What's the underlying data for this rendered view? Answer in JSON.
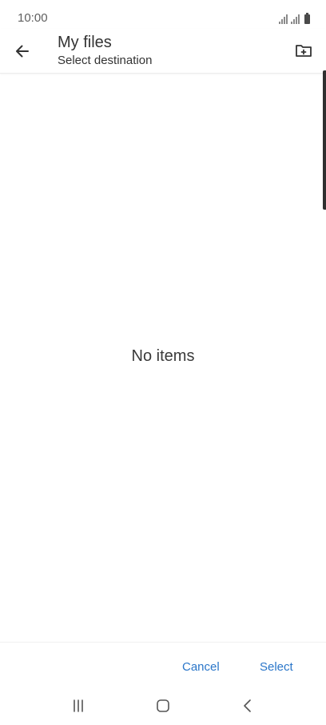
{
  "status_bar": {
    "time": "10:00",
    "icons": [
      "signal-icon",
      "signal-icon",
      "battery-icon"
    ]
  },
  "app_bar": {
    "back_icon": "arrow-left-icon",
    "title": "My files",
    "subtitle": "Select destination",
    "new_folder_icon": "new-folder-icon"
  },
  "content": {
    "empty_message": "No items"
  },
  "bottom_actions": {
    "cancel_label": "Cancel",
    "select_label": "Select",
    "accent_color": "#2a76c9"
  },
  "nav_bar": {
    "recents_icon": "recents-icon",
    "home_icon": "home-icon",
    "back_icon": "back-chevron-icon"
  }
}
